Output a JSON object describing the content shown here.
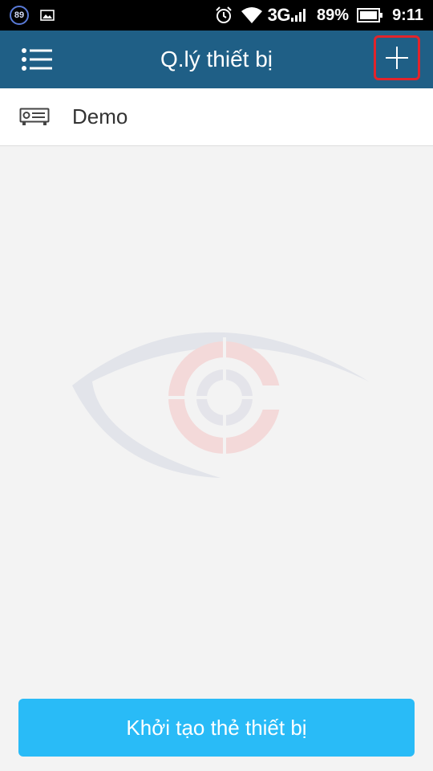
{
  "status_bar": {
    "badge_number": "89",
    "network": "3G",
    "battery_percent": "89%",
    "time": "9:11",
    "icons": [
      "notification-badge-icon",
      "image-icon",
      "alarm-icon",
      "wifi-icon",
      "signal-icon",
      "battery-icon"
    ]
  },
  "app_bar": {
    "title": "Q.lý thiết bị",
    "menu_icon": "hamburger-menu-icon",
    "add_icon": "plus-icon",
    "background": "#1f5f86",
    "highlight_color": "#e2242b"
  },
  "devices": [
    {
      "name": "Demo",
      "icon": "dvr-device-icon"
    }
  ],
  "create_button": {
    "label": "Khởi tạo thẻ thiết bị",
    "color": "#29bbf7"
  }
}
